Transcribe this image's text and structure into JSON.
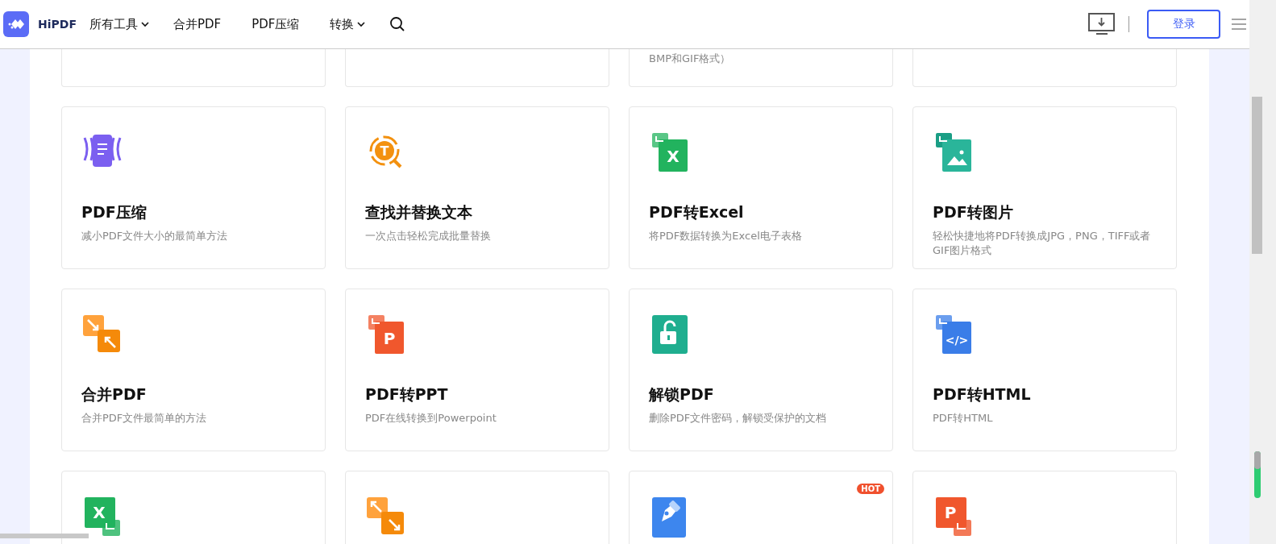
{
  "header": {
    "brand": "HiPDF",
    "nav": [
      {
        "label": "所有工具",
        "dropdown": true
      },
      {
        "label": "合并PDF",
        "dropdown": false
      },
      {
        "label": "PDF压缩",
        "dropdown": false
      },
      {
        "label": "转换",
        "dropdown": true
      }
    ],
    "login": "登录"
  },
  "partial_cards": [
    {
      "kind": "blank"
    },
    {
      "kind": "blank"
    },
    {
      "kind": "text",
      "description": "BMP和GIF格式）"
    },
    {
      "kind": "blank"
    }
  ],
  "tools": [
    {
      "kind": "compress",
      "title": "PDF压缩",
      "description": "减小PDF文件大小的最简单方法"
    },
    {
      "kind": "find",
      "icon_text": "T",
      "title": "查找并替换文本",
      "description": "一次点击轻松完成批量替换"
    },
    {
      "kind": "excel",
      "icon_text": "X",
      "title": "PDF转Excel",
      "description": "将PDF数据转换为Excel电子表格"
    },
    {
      "kind": "image",
      "title": "PDF转图片",
      "description": "轻松快捷地将PDF转换成JPG，PNG，TIFF或者GIF图片格式"
    },
    {
      "kind": "merge",
      "title": "合并PDF",
      "description": "合并PDF文件最简单的方法"
    },
    {
      "kind": "ppt",
      "icon_text": "P",
      "title": "PDF转PPT",
      "description": "PDF在线转换到Powerpoint"
    },
    {
      "kind": "unlock",
      "title": "解锁PDF",
      "description": "删除PDF文件密码，解锁受保护的文档"
    },
    {
      "kind": "html",
      "icon_text": "</>",
      "title": "PDF转HTML",
      "description": "PDF转HTML"
    },
    {
      "kind": "excel-in",
      "icon_text": "X"
    },
    {
      "kind": "split"
    },
    {
      "kind": "pen",
      "badge": "HOT"
    },
    {
      "kind": "ppt-in",
      "icon_text": "P"
    }
  ]
}
